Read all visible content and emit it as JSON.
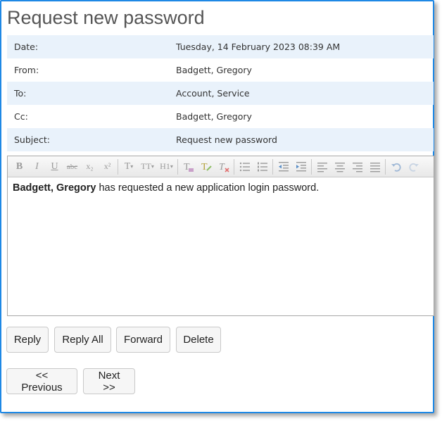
{
  "title": "Request new password",
  "fields": [
    {
      "label": "Date:",
      "value": "Tuesday, 14 February 2023 08:39 AM"
    },
    {
      "label": "From:",
      "value": "Badgett, Gregory"
    },
    {
      "label": "To:",
      "value": "Account, Service"
    },
    {
      "label": "Cc:",
      "value": "Badgett, Gregory"
    },
    {
      "label": "Subject:",
      "value": "Request new password"
    }
  ],
  "editor": {
    "body_name": "Badgett, Gregory",
    "body_text": " has requested a new application login password.",
    "toolbar": {
      "bold": "B",
      "italic": "I",
      "underline": "U",
      "strike": "abc",
      "subscript": "x₂",
      "superscript": "x²",
      "font": "T",
      "font_size": "TT",
      "heading": "H1",
      "clear": "T"
    }
  },
  "actions": {
    "reply": "Reply",
    "reply_all": "Reply All",
    "forward": "Forward",
    "delete": "Delete",
    "previous": "<< Previous",
    "next": "Next >>"
  }
}
